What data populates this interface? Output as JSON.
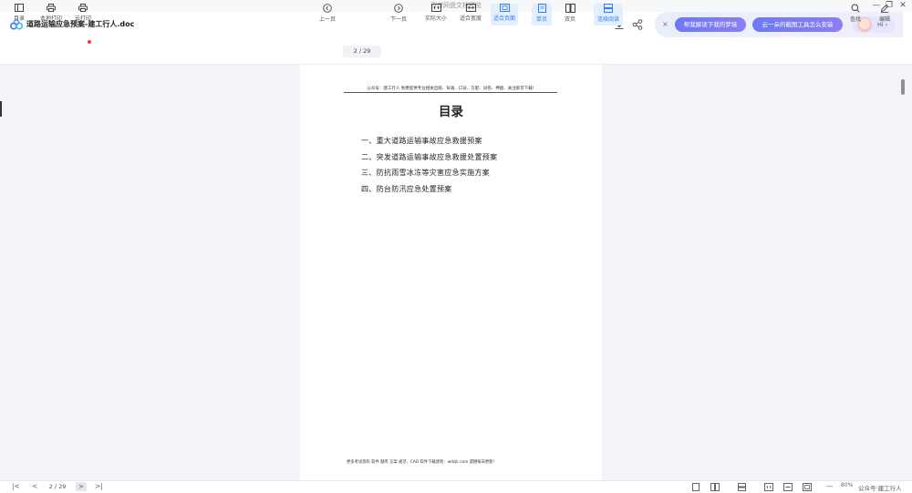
{
  "window": {
    "title": "百度网盘文档预览",
    "controls": [
      "—",
      "❐",
      "✕"
    ]
  },
  "header": {
    "doc_title": "道路运输应急预案-建工行人.doc",
    "icons": [
      "download-icon",
      "share-icon"
    ]
  },
  "ai_bar": {
    "close": "×",
    "suggestion_1": "帮我解读下我的梦境",
    "suggestion_2": "云一朵的截图工具怎么安装",
    "greeting": "Hi ›"
  },
  "toolbar": {
    "left": [
      {
        "id": "toc",
        "label": "目录",
        "icon": "sidebar-icon"
      },
      {
        "id": "local-print",
        "label": "本地打印",
        "icon": "printer-icon"
      },
      {
        "id": "cloud-print",
        "label": "云打印",
        "icon": "cloud-printer-icon"
      }
    ],
    "prev_label": "上一页",
    "page_indicator": "2  /  29",
    "next_label": "下一页",
    "view": [
      {
        "id": "actual-size",
        "label": "实际大小",
        "icon": "actual-size-icon",
        "active": false
      },
      {
        "id": "fit-width",
        "label": "适合宽度",
        "icon": "fit-width-icon",
        "active": false
      },
      {
        "id": "fit-page",
        "label": "适合页面",
        "icon": "fit-page-icon",
        "active": true
      },
      {
        "id": "single-page",
        "label": "单页",
        "icon": "single-page-icon",
        "active": true
      },
      {
        "id": "double-page",
        "label": "双页",
        "icon": "double-page-icon",
        "active": false
      },
      {
        "id": "continuous",
        "label": "连续阅读",
        "icon": "continuous-icon",
        "active": true
      }
    ],
    "right": [
      {
        "id": "search",
        "label": "查找",
        "icon": "search-icon"
      },
      {
        "id": "edit",
        "label": "编辑",
        "icon": "pencil-icon"
      }
    ]
  },
  "document": {
    "header_text": "公众号：建工行人 免费提供专业相关出版、背诵、口诀、方配、试卷、押题、关注即可下载!",
    "title": "目录",
    "toc": [
      "一、重大道路运输事故应急救援预案",
      "二、突发道路运输事故应急救援处置预案",
      "三、防抗雨雪冰冻等灾害应急实施方案",
      "四、防台防汛应急处置预案"
    ],
    "footer_text": "更多考试资料 软件 题库 方案 规范、CAD 软件下载请到：wdzjk.com 遗憾每日更新！"
  },
  "bottom_bar": {
    "first": "|<",
    "prev": "<",
    "page": "2  /  29",
    "next": ">",
    "last": ">|",
    "minus": "—",
    "zoom": "80%",
    "watermark": "公众号·建工行人"
  },
  "colors": {
    "accent": "#3a7bf5",
    "active_bg": "#e1efff",
    "pill": "#7b7cf4",
    "badge": "#f0374e"
  }
}
